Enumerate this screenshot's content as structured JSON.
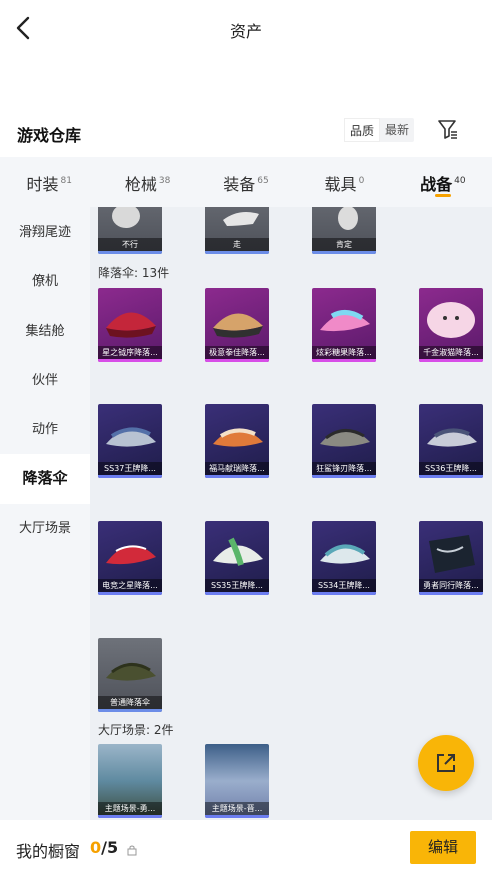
{
  "header": {
    "title": "资产"
  },
  "warehouse": {
    "title": "游戏仓库",
    "sort_options": [
      "品质",
      "最新"
    ]
  },
  "tabs": [
    {
      "label": "时装",
      "count": "81"
    },
    {
      "label": "枪械",
      "count": "38"
    },
    {
      "label": "装备",
      "count": "65"
    },
    {
      "label": "载具",
      "count": "0"
    },
    {
      "label": "战备",
      "count": "40",
      "active": true
    }
  ],
  "sidebar": [
    "滑翔尾迹",
    "僚机",
    "集结舱",
    "伙伴",
    "动作",
    "降落伞",
    "大厅场景"
  ],
  "actions_row": [
    {
      "name": "不行"
    },
    {
      "name": "走"
    },
    {
      "name": "肯定"
    }
  ],
  "parachute_group": {
    "label": "降落伞: 13件",
    "items": [
      {
        "name": "星之钺序降落...",
        "rarity": "purple"
      },
      {
        "name": "极意拳佳降落...",
        "rarity": "purple"
      },
      {
        "name": "炫彩糖果降落...",
        "rarity": "purple"
      },
      {
        "name": "千金淑猫降落...",
        "rarity": "purple"
      },
      {
        "name": "SS37王牌降...",
        "rarity": "blue"
      },
      {
        "name": "福马献瑞降落...",
        "rarity": "blue"
      },
      {
        "name": "狂鲨锋刃降落...",
        "rarity": "blue"
      },
      {
        "name": "SS36王牌降...",
        "rarity": "blue"
      },
      {
        "name": "电竞之星降落...",
        "rarity": "blue"
      },
      {
        "name": "SS35王牌降...",
        "rarity": "blue"
      },
      {
        "name": "SS34王牌降...",
        "rarity": "blue"
      },
      {
        "name": "勇者同行降落...",
        "rarity": "blue"
      },
      {
        "name": "普通降落伞",
        "rarity": "gray"
      }
    ]
  },
  "lobby_group": {
    "label": "大厅场景: 2件",
    "items": [
      {
        "name": "主题场景-勇..."
      },
      {
        "name": "主题场景-晋..."
      }
    ]
  },
  "showcase": {
    "label": "我的橱窗",
    "current": "0",
    "total": "/5"
  },
  "edit_label": "编辑",
  "colors": {
    "accent": "#f9b507",
    "purple_rarity": "#d84ee8",
    "blue_rarity": "#6c7df0"
  }
}
